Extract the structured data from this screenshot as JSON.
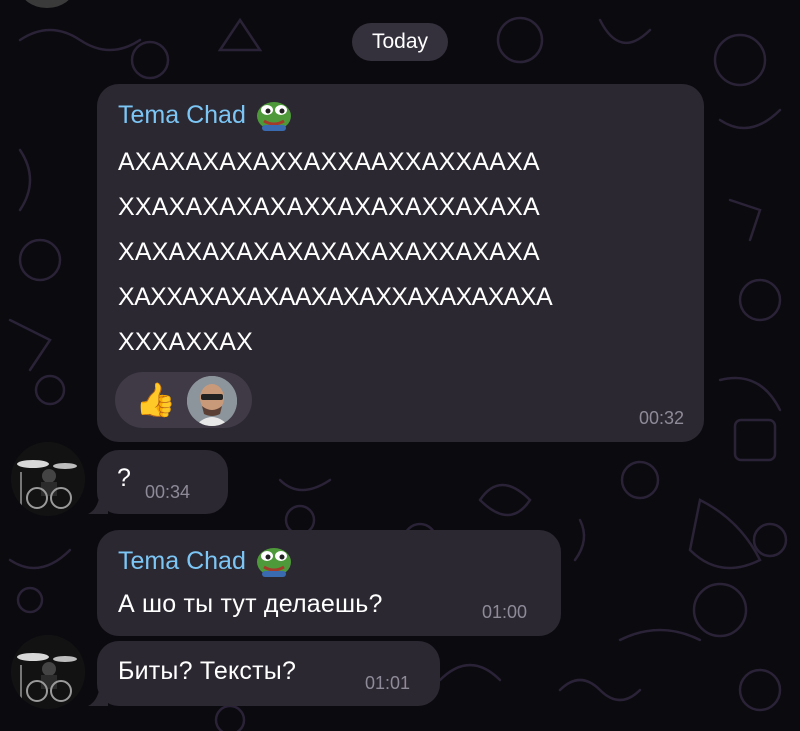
{
  "date_separator": "Today",
  "messages": [
    {
      "sender": "Tema Chad",
      "lines": [
        "АХАХАХАХАХХАХХААХХАХХААХА",
        "ХХАХАХАХАХАХХАХАХАХХАХАХА",
        "ХАХАХАХАХАХАХАХАХАХХАХАХА",
        "ХАХХАХАХАХААХАХАХХАХАХАХАХА",
        "ХХХАХХАХ"
      ],
      "reactions": {
        "emoji": "👍"
      },
      "time": "00:32"
    },
    {
      "text": "?",
      "time": "00:34"
    },
    {
      "sender": "Tema Chad",
      "text": "А шо ты тут делаешь?",
      "time": "01:00"
    },
    {
      "text": "Биты? Тексты?",
      "time": "01:01"
    }
  ],
  "colors": {
    "background": "#0b0a0f",
    "bubble": "#2c2832",
    "sender_name": "#7cc6f5",
    "time": "#8f8a97",
    "reaction_pill": "#3f3a46",
    "date_pill": "#3c3744"
  },
  "icons": [
    "pepe-sticker-icon",
    "thumbs-up-icon",
    "avatar-photo"
  ]
}
